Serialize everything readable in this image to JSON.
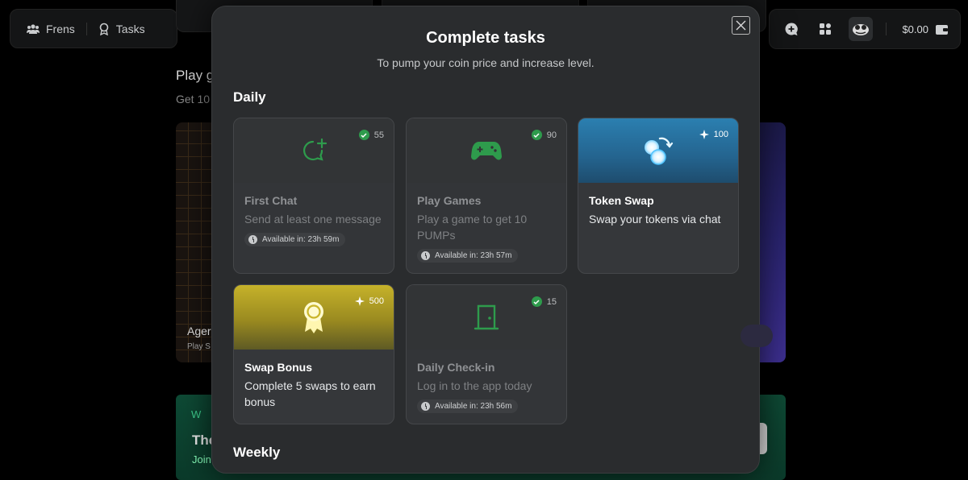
{
  "nav": {
    "frens": "Frens",
    "tasks": "Tasks"
  },
  "wallet": {
    "balance": "$0.00"
  },
  "background": {
    "heading": "Play g",
    "subheading": "Get 10",
    "game_title": "Ager",
    "game_sub": "Play S",
    "promo_mark": "W",
    "promo_title": "The",
    "promo_sub": "Join"
  },
  "modal": {
    "title": "Complete tasks",
    "subtitle": "To pump your coin price and increase level.",
    "daily_label": "Daily",
    "weekly_label": "Weekly",
    "daily_tasks": [
      {
        "title": "First Chat",
        "desc": "Send at least one message",
        "reward": "55",
        "timer": "Available in: 23h 59m",
        "status": "completed",
        "icon": "chat-plus-icon"
      },
      {
        "title": "Play Games",
        "desc": "Play a game to get 10 PUMPs",
        "reward": "90",
        "timer": "Available in: 23h 57m",
        "status": "completed",
        "icon": "gamepad-icon"
      },
      {
        "title": "Token Swap",
        "desc": "Swap your tokens via chat",
        "reward": "100",
        "timer": "",
        "status": "available",
        "icon": "token-swap-icon"
      },
      {
        "title": "Swap Bonus",
        "desc": "Complete 5 swaps to earn bonus",
        "reward": "500",
        "timer": "",
        "status": "available",
        "icon": "award-ribbon-icon"
      },
      {
        "title": "Daily Check-in",
        "desc": "Log in to the app today",
        "reward": "15",
        "timer": "Available in: 23h 56m",
        "status": "completed",
        "icon": "door-icon"
      }
    ]
  },
  "colors": {
    "completed_green": "#2e9b4c",
    "swap_banner": "#2e8bbf",
    "bonus_banner": "#c9b52a"
  }
}
